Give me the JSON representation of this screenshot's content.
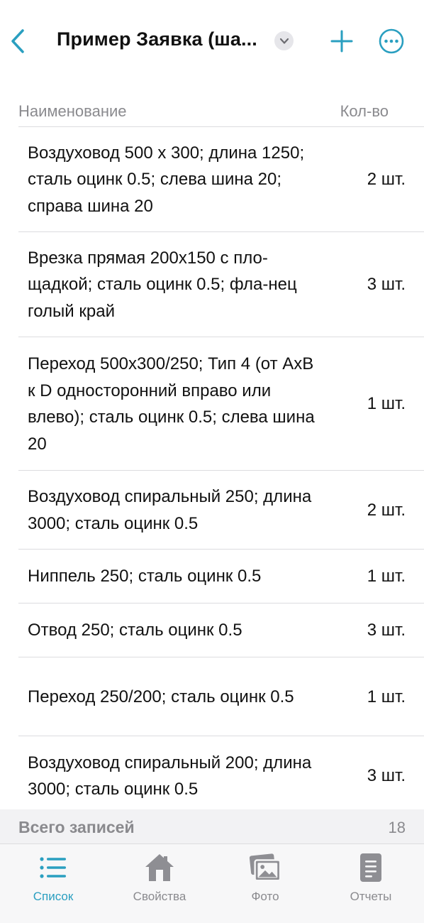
{
  "header": {
    "title": "Пример Заявка (ша..."
  },
  "columns": {
    "name": "Наименование",
    "qty": "Кол-во"
  },
  "items": [
    {
      "name": "Воздуховод 500 x 300; длина 1250; сталь оцинк 0.5; слева шина 20; справа шина 20",
      "qty": "2 шт."
    },
    {
      "name": "Врезка прямая 200x150 с пло-щадкой; сталь оцинк 0.5; фла-нец голый край",
      "qty": "3 шт."
    },
    {
      "name": "Переход 500x300/250; Тип 4 (от AxB к D односторонний вправо или влево); сталь оцинк 0.5; слева шина 20",
      "qty": "1 шт."
    },
    {
      "name": "Воздуховод спиральный 250; длина 3000; сталь оцинк 0.5",
      "qty": "2 шт."
    },
    {
      "name": "Ниппель 250; сталь оцинк 0.5",
      "qty": "1 шт."
    },
    {
      "name": "Отвод 250; сталь оцинк 0.5",
      "qty": "3 шт."
    },
    {
      "name": "Переход 250/200; сталь оцинк 0.5",
      "qty": "1 шт."
    },
    {
      "name": "Воздуховод спиральный 200; длина 3000; сталь оцинк 0.5",
      "qty": "3 шт."
    }
  ],
  "summary": {
    "label": "Всего записей",
    "count": "18"
  },
  "tabs": [
    {
      "label": "Список",
      "icon": "list-icon",
      "active": true
    },
    {
      "label": "Свойства",
      "icon": "house-icon",
      "active": false
    },
    {
      "label": "Фото",
      "icon": "photos-icon",
      "active": false
    },
    {
      "label": "Отчеты",
      "icon": "document-icon",
      "active": false
    }
  ],
  "colors": {
    "accent": "#2a9fc0",
    "secondary_text": "#8a8a8e",
    "inactive_icon": "#8e8e93"
  }
}
